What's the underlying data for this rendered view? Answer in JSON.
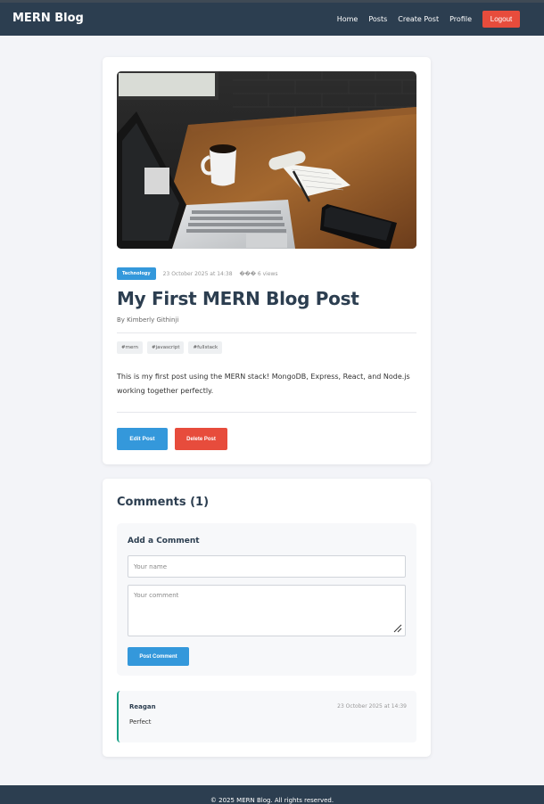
{
  "nav": {
    "brand": "MERN Blog",
    "links": [
      "Home",
      "Posts",
      "Create Post",
      "Profile"
    ],
    "logout_label": "Logout"
  },
  "post": {
    "category": "Technology",
    "date": "23 October 2025 at 14:38",
    "views": "��� 6 views",
    "title": "My First MERN Blog Post",
    "author": "By Kimberly Githinji",
    "tags": [
      "#mern",
      "#javascript",
      "#fullstack"
    ],
    "body": "This is my first post using the MERN stack! MongoDB, Express, React, and Node.js working together perfectly.",
    "edit_label": "Edit Post",
    "delete_label": "Delete Post"
  },
  "comments": {
    "heading": "Comments (1)",
    "form": {
      "title": "Add a Comment",
      "name_placeholder": "Your name",
      "comment_placeholder": "Your comment",
      "submit_label": "Post Comment"
    },
    "items": [
      {
        "author": "Reagan",
        "date": "23 October 2025 at 14:39",
        "text": "Perfect"
      }
    ]
  },
  "footer": {
    "text": "© 2025 MERN Blog. All rights reserved."
  },
  "colors": {
    "navbar": "#2c3e50",
    "accent": "#3498db",
    "danger": "#e74c3c",
    "comment_border": "#16a085"
  }
}
